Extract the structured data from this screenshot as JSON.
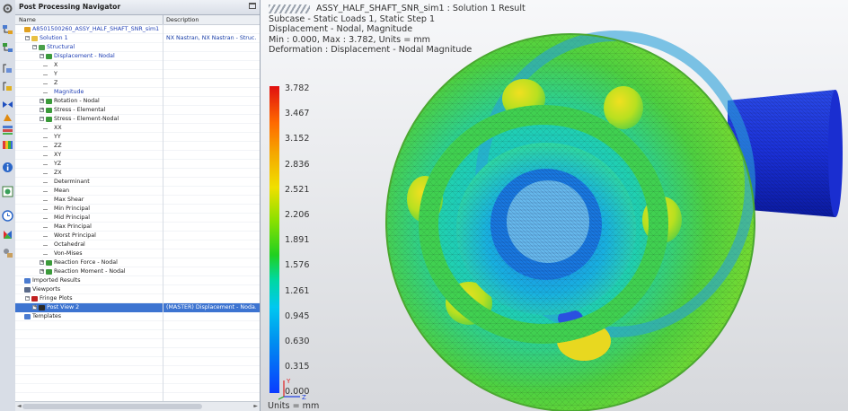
{
  "navigator": {
    "title": "Post Processing Navigator",
    "col_name": "Name",
    "col_desc": "Description",
    "rows": [
      {
        "label": "A8501500260_ASSY_HALF_SHAFT_SNR_sim1",
        "desc": "",
        "indent": 0,
        "color": "blue",
        "icon": "sim-icon",
        "exp": ""
      },
      {
        "label": "Solution 1",
        "desc": "NX Nastran, NX Nastran - Struc...",
        "indent": 1,
        "color": "blue",
        "icon": "folder-icon",
        "exp": "−"
      },
      {
        "label": "Structural",
        "desc": "",
        "indent": 2,
        "color": "blue",
        "icon": "structural-icon",
        "exp": "−"
      },
      {
        "label": "Displacement - Nodal",
        "desc": "",
        "indent": 3,
        "color": "blue",
        "icon": "result-icon",
        "exp": "−"
      },
      {
        "label": "X",
        "desc": "",
        "indent": 4,
        "color": "black",
        "icon": "",
        "exp": ""
      },
      {
        "label": "Y",
        "desc": "",
        "indent": 4,
        "color": "black",
        "icon": "",
        "exp": ""
      },
      {
        "label": "Z",
        "desc": "",
        "indent": 4,
        "color": "black",
        "icon": "",
        "exp": ""
      },
      {
        "label": "Magnitude",
        "desc": "",
        "indent": 4,
        "color": "blue",
        "icon": "",
        "exp": ""
      },
      {
        "label": "Rotation - Nodal",
        "desc": "",
        "indent": 3,
        "color": "black",
        "icon": "result-icon",
        "exp": "+"
      },
      {
        "label": "Stress - Elemental",
        "desc": "",
        "indent": 3,
        "color": "black",
        "icon": "result-icon",
        "exp": "+"
      },
      {
        "label": "Stress - Element-Nodal",
        "desc": "",
        "indent": 3,
        "color": "black",
        "icon": "result-icon",
        "exp": "−"
      },
      {
        "label": "XX",
        "desc": "",
        "indent": 4,
        "color": "black",
        "icon": "",
        "exp": ""
      },
      {
        "label": "YY",
        "desc": "",
        "indent": 4,
        "color": "black",
        "icon": "",
        "exp": ""
      },
      {
        "label": "ZZ",
        "desc": "",
        "indent": 4,
        "color": "black",
        "icon": "",
        "exp": ""
      },
      {
        "label": "XY",
        "desc": "",
        "indent": 4,
        "color": "black",
        "icon": "",
        "exp": ""
      },
      {
        "label": "YZ",
        "desc": "",
        "indent": 4,
        "color": "black",
        "icon": "",
        "exp": ""
      },
      {
        "label": "ZX",
        "desc": "",
        "indent": 4,
        "color": "black",
        "icon": "",
        "exp": ""
      },
      {
        "label": "Determinant",
        "desc": "",
        "indent": 4,
        "color": "black",
        "icon": "",
        "exp": ""
      },
      {
        "label": "Mean",
        "desc": "",
        "indent": 4,
        "color": "black",
        "icon": "",
        "exp": ""
      },
      {
        "label": "Max Shear",
        "desc": "",
        "indent": 4,
        "color": "black",
        "icon": "",
        "exp": ""
      },
      {
        "label": "Min Principal",
        "desc": "",
        "indent": 4,
        "color": "black",
        "icon": "",
        "exp": ""
      },
      {
        "label": "Mid Principal",
        "desc": "",
        "indent": 4,
        "color": "black",
        "icon": "",
        "exp": ""
      },
      {
        "label": "Max Principal",
        "desc": "",
        "indent": 4,
        "color": "black",
        "icon": "",
        "exp": ""
      },
      {
        "label": "Worst Principal",
        "desc": "",
        "indent": 4,
        "color": "black",
        "icon": "",
        "exp": ""
      },
      {
        "label": "Octahedral",
        "desc": "",
        "indent": 4,
        "color": "black",
        "icon": "",
        "exp": ""
      },
      {
        "label": "Von-Mises",
        "desc": "",
        "indent": 4,
        "color": "black",
        "icon": "",
        "exp": ""
      },
      {
        "label": "Reaction Force - Nodal",
        "desc": "",
        "indent": 3,
        "color": "black",
        "icon": "result-icon",
        "exp": "+"
      },
      {
        "label": "Reaction Moment - Nodal",
        "desc": "",
        "indent": 3,
        "color": "black",
        "icon": "result-icon",
        "exp": "+"
      },
      {
        "label": "Imported Results",
        "desc": "",
        "indent": 0,
        "color": "black",
        "icon": "imported-icon",
        "exp": ""
      },
      {
        "label": "Viewports",
        "desc": "",
        "indent": 0,
        "color": "black",
        "icon": "viewport-icon",
        "exp": ""
      },
      {
        "label": "Fringe Plots",
        "desc": "",
        "indent": 1,
        "color": "black",
        "icon": "fringe-icon",
        "exp": "−"
      },
      {
        "label": "Post View 2",
        "desc": "(MASTER) Displacement - Noda...",
        "indent": 2,
        "color": "black",
        "icon": "postview-icon",
        "exp": "+",
        "selected": true
      },
      {
        "label": "Templates",
        "desc": "",
        "indent": 0,
        "color": "black",
        "icon": "templates-icon",
        "exp": ""
      }
    ]
  },
  "viewport": {
    "title_line": "ASSY_HALF_SHAFT_SNR_sim1 : Solution 1 Result",
    "subcase": "Subcase - Static Loads 1, Static Step 1",
    "result": "Displacement - Nodal, Magnitude",
    "minmax": "Min : 0.000, Max : 3.782, Units = mm",
    "deformation": "Deformation : Displacement - Nodal Magnitude",
    "units": "Units = mm"
  },
  "legend": {
    "values": [
      "3.782",
      "3.467",
      "3.152",
      "2.836",
      "2.521",
      "2.206",
      "1.891",
      "1.576",
      "1.261",
      "0.945",
      "0.630",
      "0.315",
      "0.000"
    ]
  },
  "colors": {
    "selection": "#3d74d1",
    "link_blue": "#1f3fb5",
    "legend_max": "#e01010",
    "legend_min": "#0a3cff"
  }
}
